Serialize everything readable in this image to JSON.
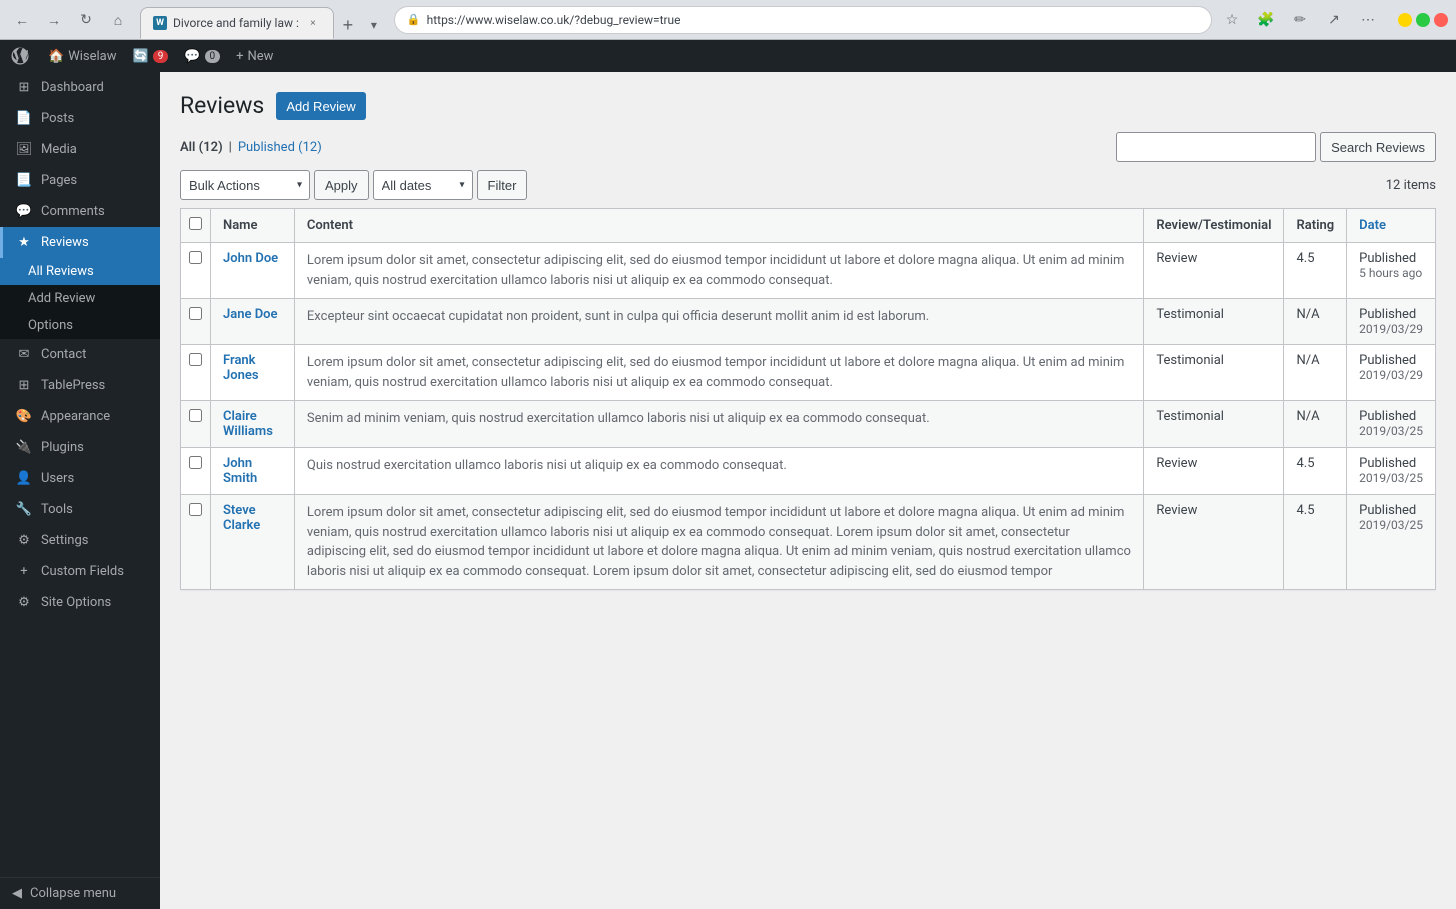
{
  "browser": {
    "url": "https://www.wiselaw.co.uk/?debug_review=true",
    "tab_title": "Divorce and family law :",
    "tab_favicon": "W",
    "new_tab_title": "New Tab",
    "back_btn": "←",
    "forward_btn": "→",
    "refresh_btn": "↻",
    "home_btn": "⌂",
    "star_btn": "☆",
    "menu_btn": "⋯"
  },
  "admin_bar": {
    "wp_icon": "W",
    "site_name": "Wiselaw",
    "updates_count": "9",
    "comments_count": "0",
    "new_label": "New"
  },
  "sidebar": {
    "items": [
      {
        "id": "dashboard",
        "label": "Dashboard",
        "icon": "⊞"
      },
      {
        "id": "posts",
        "label": "Posts",
        "icon": "📄"
      },
      {
        "id": "media",
        "label": "Media",
        "icon": "🖼"
      },
      {
        "id": "pages",
        "label": "Pages",
        "icon": "📃"
      },
      {
        "id": "comments",
        "label": "Comments",
        "icon": "💬"
      },
      {
        "id": "reviews",
        "label": "Reviews",
        "icon": "★",
        "active": true
      },
      {
        "id": "contact",
        "label": "Contact",
        "icon": "✉"
      },
      {
        "id": "tablepress",
        "label": "TablePress",
        "icon": "⊞"
      },
      {
        "id": "appearance",
        "label": "Appearance",
        "icon": "🎨"
      },
      {
        "id": "plugins",
        "label": "Plugins",
        "icon": "🔌"
      },
      {
        "id": "users",
        "label": "Users",
        "icon": "👤"
      },
      {
        "id": "tools",
        "label": "Tools",
        "icon": "🔧"
      },
      {
        "id": "settings",
        "label": "Settings",
        "icon": "⚙"
      },
      {
        "id": "custom-fields",
        "label": "Custom Fields",
        "icon": "+"
      },
      {
        "id": "site-options",
        "label": "Site Options",
        "icon": "⚙"
      }
    ],
    "submenu": {
      "reviews": [
        {
          "id": "all-reviews",
          "label": "All Reviews",
          "active": true
        },
        {
          "id": "add-review",
          "label": "Add Review",
          "active": false
        },
        {
          "id": "options",
          "label": "Options",
          "active": false
        }
      ]
    },
    "collapse_label": "Collapse menu"
  },
  "page": {
    "title": "Reviews",
    "add_new_label": "Add Review",
    "filter": {
      "all_label": "All",
      "all_count": "12",
      "published_label": "Published",
      "published_count": "12",
      "search_placeholder": "",
      "search_btn_label": "Search Reviews",
      "bulk_actions_label": "Bulk Actions",
      "apply_label": "Apply",
      "dates_label": "All dates",
      "filter_label": "Filter",
      "item_count": "12 items"
    },
    "table": {
      "columns": [
        {
          "id": "cb",
          "label": ""
        },
        {
          "id": "name",
          "label": "Name"
        },
        {
          "id": "content",
          "label": "Content"
        },
        {
          "id": "type",
          "label": "Review/Testimonial"
        },
        {
          "id": "rating",
          "label": "Rating"
        },
        {
          "id": "date",
          "label": "Date"
        }
      ],
      "rows": [
        {
          "id": 1,
          "name": "John Doe",
          "content": "Lorem ipsum dolor sit amet, consectetur adipiscing elit, sed do eiusmod tempor incididunt ut labore et dolore magna aliqua. Ut enim ad minim veniam, quis nostrud exercitation ullamco laboris nisi ut aliquip ex ea commodo consequat.",
          "type": "Review",
          "rating": "4.5",
          "date_status": "Published",
          "date_relative": "5 hours ago"
        },
        {
          "id": 2,
          "name": "Jane Doe",
          "content": "Excepteur sint occaecat cupidatat non proident, sunt in culpa qui officia deserunt mollit anim id est laborum.",
          "type": "Testimonial",
          "rating": "N/A",
          "date_status": "Published",
          "date_value": "2019/03/29"
        },
        {
          "id": 3,
          "name": "Frank Jones",
          "content": "Lorem ipsum dolor sit amet, consectetur adipiscing elit, sed do eiusmod tempor incididunt ut labore et dolore magna aliqua. Ut enim ad minim veniam, quis nostrud exercitation ullamco laboris nisi ut aliquip ex ea commodo consequat.",
          "type": "Testimonial",
          "rating": "N/A",
          "date_status": "Published",
          "date_value": "2019/03/29"
        },
        {
          "id": 4,
          "name": "Claire Williams",
          "content": "Senim ad minim veniam, quis nostrud exercitation ullamco laboris nisi ut aliquip ex ea commodo consequat.",
          "type": "Testimonial",
          "rating": "N/A",
          "date_status": "Published",
          "date_value": "2019/03/25"
        },
        {
          "id": 5,
          "name": "John Smith",
          "content": "Quis nostrud exercitation ullamco laboris nisi ut aliquip ex ea commodo consequat.",
          "type": "Review",
          "rating": "4.5",
          "date_status": "Published",
          "date_value": "2019/03/25"
        },
        {
          "id": 6,
          "name": "Steve Clarke",
          "content": "Lorem ipsum dolor sit amet, consectetur adipiscing elit, sed do eiusmod tempor incididunt ut labore et dolore magna aliqua. Ut enim ad minim veniam, quis nostrud exercitation ullamco laboris nisi ut aliquip ex ea commodo consequat. Lorem ipsum dolor sit amet, consectetur adipiscing elit, sed do eiusmod tempor incididunt ut labore et dolore magna aliqua. Ut enim ad minim veniam, quis nostrud exercitation ullamco laboris nisi ut aliquip ex ea commodo consequat. Lorem ipsum dolor sit amet, consectetur adipiscing elit, sed do eiusmod tempor",
          "type": "Review",
          "rating": "4.5",
          "date_status": "Published",
          "date_value": "2019/03/25"
        }
      ]
    }
  }
}
